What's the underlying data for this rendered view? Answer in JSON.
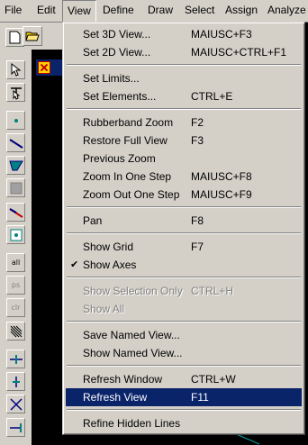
{
  "menubar": {
    "items": [
      "File",
      "Edit",
      "View",
      "Define",
      "Draw",
      "Select",
      "Assign",
      "Analyze"
    ]
  },
  "view_menu": {
    "groups": [
      [
        {
          "label": "Set 3D View...",
          "shortcut": "MAIUSC+F3"
        },
        {
          "label": "Set 2D View...",
          "shortcut": "MAIUSC+CTRL+F1"
        }
      ],
      [
        {
          "label": "Set Limits...",
          "shortcut": ""
        },
        {
          "label": "Set Elements...",
          "shortcut": "CTRL+E"
        }
      ],
      [
        {
          "label": "Rubberband Zoom",
          "shortcut": "F2"
        },
        {
          "label": "Restore Full View",
          "shortcut": "F3"
        },
        {
          "label": "Previous Zoom",
          "shortcut": ""
        },
        {
          "label": "Zoom In One Step",
          "shortcut": "MAIUSC+F8"
        },
        {
          "label": "Zoom Out One Step",
          "shortcut": "MAIUSC+F9"
        }
      ],
      [
        {
          "label": "Pan",
          "shortcut": "F8"
        }
      ],
      [
        {
          "label": "Show Grid",
          "shortcut": "F7"
        },
        {
          "label": "Show Axes",
          "shortcut": "",
          "checked": true
        }
      ],
      [
        {
          "label": "Show Selection Only",
          "shortcut": "CTRL+H",
          "disabled": true
        },
        {
          "label": "Show All",
          "shortcut": "",
          "disabled": true
        }
      ],
      [
        {
          "label": "Save Named View...",
          "shortcut": ""
        },
        {
          "label": "Show Named View...",
          "shortcut": ""
        }
      ],
      [
        {
          "label": "Refresh Window",
          "shortcut": "CTRL+W"
        },
        {
          "label": "Refresh View",
          "shortcut": "F11",
          "highlighted": true
        }
      ],
      [
        {
          "label": "Refine Hidden Lines",
          "shortcut": ""
        }
      ]
    ],
    "check_glyph": "✔"
  },
  "toolbar": {
    "icons": [
      "new-file-icon",
      "open-file-icon",
      "pointer-icon",
      "reshape-pointer-icon",
      "point-icon",
      "line-icon",
      "area-icon",
      "grid-area-icon",
      "draw-line-icon",
      "snap-point-icon",
      "select-all-icon",
      "select-ps-icon",
      "clear-selection-icon",
      "intersect-icon",
      "snap-icon",
      "vertical-snap-icon",
      "cross-snap-icon",
      "extend-icon"
    ],
    "text_buttons": {
      "all": "all",
      "ps": "ps",
      "clr": "clr"
    }
  },
  "colors": {
    "menu_bg": "#d4d0c8",
    "highlight": "#0a246a",
    "canvas": "#000000"
  }
}
